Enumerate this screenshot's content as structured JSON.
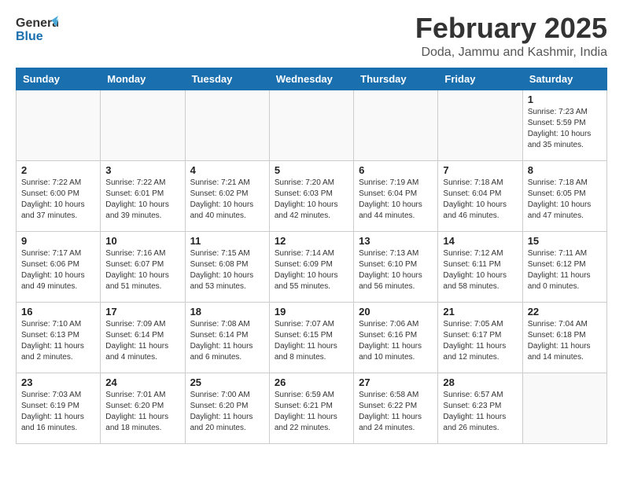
{
  "header": {
    "logo_general": "General",
    "logo_blue": "Blue",
    "title": "February 2025",
    "location": "Doda, Jammu and Kashmir, India"
  },
  "weekdays": [
    "Sunday",
    "Monday",
    "Tuesday",
    "Wednesday",
    "Thursday",
    "Friday",
    "Saturday"
  ],
  "weeks": [
    [
      {
        "day": "",
        "info": ""
      },
      {
        "day": "",
        "info": ""
      },
      {
        "day": "",
        "info": ""
      },
      {
        "day": "",
        "info": ""
      },
      {
        "day": "",
        "info": ""
      },
      {
        "day": "",
        "info": ""
      },
      {
        "day": "1",
        "info": "Sunrise: 7:23 AM\nSunset: 5:59 PM\nDaylight: 10 hours and 35 minutes."
      }
    ],
    [
      {
        "day": "2",
        "info": "Sunrise: 7:22 AM\nSunset: 6:00 PM\nDaylight: 10 hours and 37 minutes."
      },
      {
        "day": "3",
        "info": "Sunrise: 7:22 AM\nSunset: 6:01 PM\nDaylight: 10 hours and 39 minutes."
      },
      {
        "day": "4",
        "info": "Sunrise: 7:21 AM\nSunset: 6:02 PM\nDaylight: 10 hours and 40 minutes."
      },
      {
        "day": "5",
        "info": "Sunrise: 7:20 AM\nSunset: 6:03 PM\nDaylight: 10 hours and 42 minutes."
      },
      {
        "day": "6",
        "info": "Sunrise: 7:19 AM\nSunset: 6:04 PM\nDaylight: 10 hours and 44 minutes."
      },
      {
        "day": "7",
        "info": "Sunrise: 7:18 AM\nSunset: 6:04 PM\nDaylight: 10 hours and 46 minutes."
      },
      {
        "day": "8",
        "info": "Sunrise: 7:18 AM\nSunset: 6:05 PM\nDaylight: 10 hours and 47 minutes."
      }
    ],
    [
      {
        "day": "9",
        "info": "Sunrise: 7:17 AM\nSunset: 6:06 PM\nDaylight: 10 hours and 49 minutes."
      },
      {
        "day": "10",
        "info": "Sunrise: 7:16 AM\nSunset: 6:07 PM\nDaylight: 10 hours and 51 minutes."
      },
      {
        "day": "11",
        "info": "Sunrise: 7:15 AM\nSunset: 6:08 PM\nDaylight: 10 hours and 53 minutes."
      },
      {
        "day": "12",
        "info": "Sunrise: 7:14 AM\nSunset: 6:09 PM\nDaylight: 10 hours and 55 minutes."
      },
      {
        "day": "13",
        "info": "Sunrise: 7:13 AM\nSunset: 6:10 PM\nDaylight: 10 hours and 56 minutes."
      },
      {
        "day": "14",
        "info": "Sunrise: 7:12 AM\nSunset: 6:11 PM\nDaylight: 10 hours and 58 minutes."
      },
      {
        "day": "15",
        "info": "Sunrise: 7:11 AM\nSunset: 6:12 PM\nDaylight: 11 hours and 0 minutes."
      }
    ],
    [
      {
        "day": "16",
        "info": "Sunrise: 7:10 AM\nSunset: 6:13 PM\nDaylight: 11 hours and 2 minutes."
      },
      {
        "day": "17",
        "info": "Sunrise: 7:09 AM\nSunset: 6:14 PM\nDaylight: 11 hours and 4 minutes."
      },
      {
        "day": "18",
        "info": "Sunrise: 7:08 AM\nSunset: 6:14 PM\nDaylight: 11 hours and 6 minutes."
      },
      {
        "day": "19",
        "info": "Sunrise: 7:07 AM\nSunset: 6:15 PM\nDaylight: 11 hours and 8 minutes."
      },
      {
        "day": "20",
        "info": "Sunrise: 7:06 AM\nSunset: 6:16 PM\nDaylight: 11 hours and 10 minutes."
      },
      {
        "day": "21",
        "info": "Sunrise: 7:05 AM\nSunset: 6:17 PM\nDaylight: 11 hours and 12 minutes."
      },
      {
        "day": "22",
        "info": "Sunrise: 7:04 AM\nSunset: 6:18 PM\nDaylight: 11 hours and 14 minutes."
      }
    ],
    [
      {
        "day": "23",
        "info": "Sunrise: 7:03 AM\nSunset: 6:19 PM\nDaylight: 11 hours and 16 minutes."
      },
      {
        "day": "24",
        "info": "Sunrise: 7:01 AM\nSunset: 6:20 PM\nDaylight: 11 hours and 18 minutes."
      },
      {
        "day": "25",
        "info": "Sunrise: 7:00 AM\nSunset: 6:20 PM\nDaylight: 11 hours and 20 minutes."
      },
      {
        "day": "26",
        "info": "Sunrise: 6:59 AM\nSunset: 6:21 PM\nDaylight: 11 hours and 22 minutes."
      },
      {
        "day": "27",
        "info": "Sunrise: 6:58 AM\nSunset: 6:22 PM\nDaylight: 11 hours and 24 minutes."
      },
      {
        "day": "28",
        "info": "Sunrise: 6:57 AM\nSunset: 6:23 PM\nDaylight: 11 hours and 26 minutes."
      },
      {
        "day": "",
        "info": ""
      }
    ]
  ]
}
